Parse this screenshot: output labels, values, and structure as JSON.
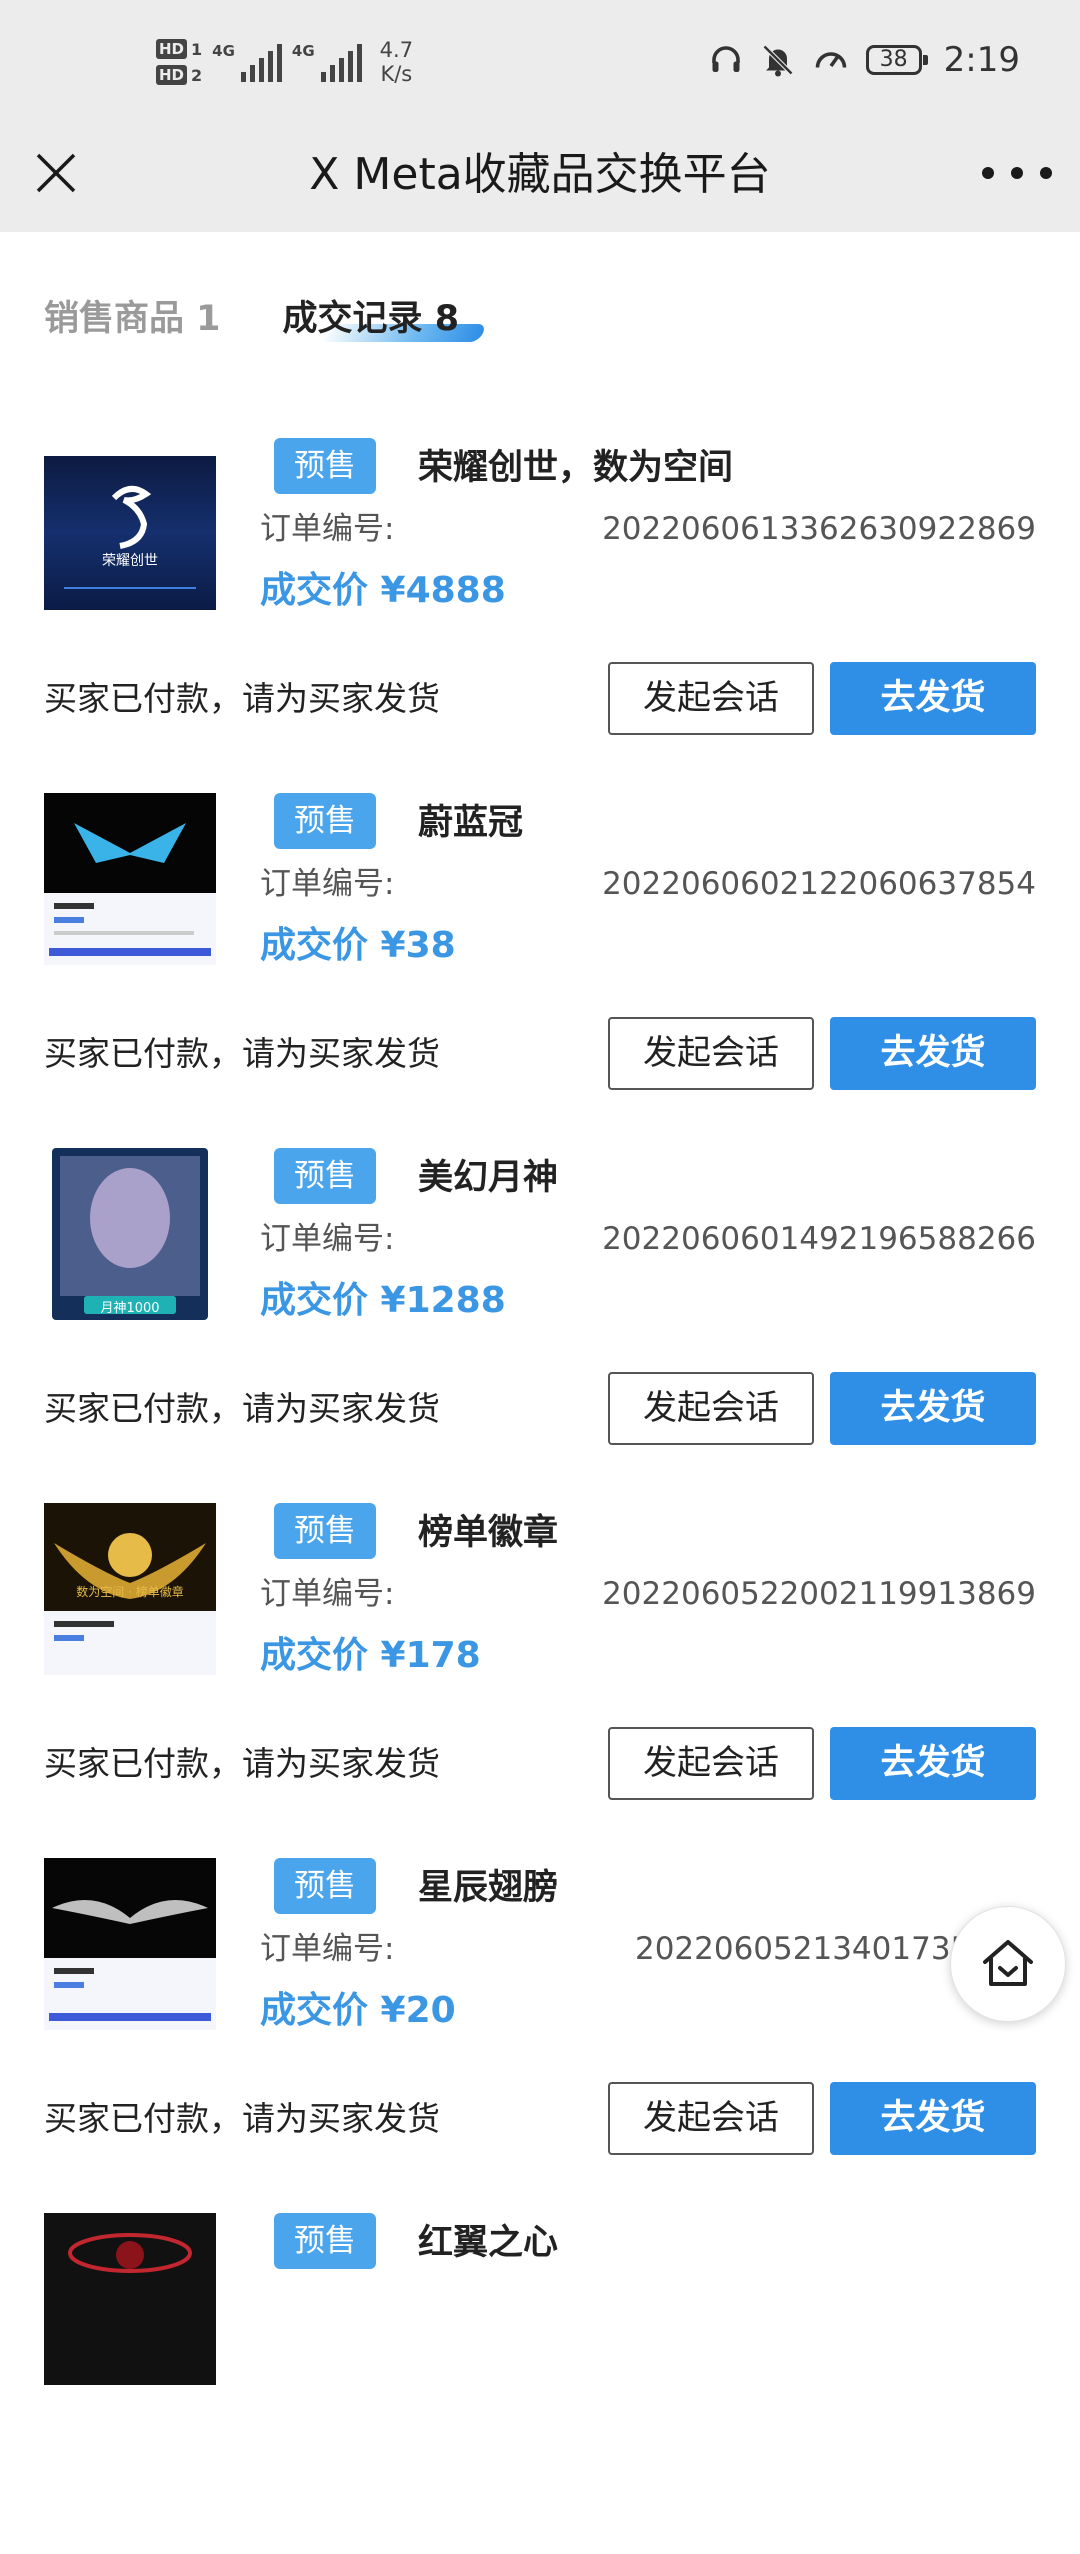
{
  "status_bar": {
    "hd1": "HD",
    "hd1_num": "1",
    "hd2": "HD",
    "hd2_num": "2",
    "net1": "4G",
    "net2": "4G",
    "speed_value": "4.7",
    "speed_unit": "K/s",
    "battery": "38",
    "time": "2:19"
  },
  "title_bar": {
    "title": "X Meta收藏品交换平台"
  },
  "tabs": [
    {
      "label": "销售商品 1",
      "active": false
    },
    {
      "label": "成交记录 8",
      "active": true
    }
  ],
  "common": {
    "badge": "预售",
    "order_label": "订单编号:",
    "status": "买家已付款，请为买家发货",
    "chat_button": "发起会话",
    "ship_button": "去发货"
  },
  "orders": [
    {
      "name": "荣耀创世，数为空间",
      "order_no": "20220606133626309228​69",
      "price": "成交价 ¥4888",
      "thumb_text": "荣耀创世"
    },
    {
      "name": "蔚蓝冠",
      "order_no": "2022060602122060637854",
      "price": "成交价 ¥38",
      "thumb_text": ""
    },
    {
      "name": "美幻月神",
      "order_no": "2022060601492196588266",
      "price": "成交价 ¥1288",
      "thumb_text": "月神1000"
    },
    {
      "name": "榜单徽章",
      "order_no": "2022060522002119913869",
      "price": "成交价 ¥178",
      "thumb_text": "数为空间 · 榜单徽章"
    },
    {
      "name": "星辰翅膀",
      "order_no": "20220605213401735​7",
      "price": "成交价 ¥20",
      "thumb_text": ""
    },
    {
      "name": "红翼之心",
      "order_no": "",
      "price": "",
      "thumb_text": ""
    }
  ],
  "colors": {
    "accent": "#2f8ee6",
    "badge": "#4aa5ec",
    "price": "#3b97e4",
    "header_bg": "#ececec"
  },
  "icons": [
    "headphones-icon",
    "bell-muted-icon",
    "speedometer-icon",
    "close-icon",
    "more-icon",
    "home-icon"
  ]
}
